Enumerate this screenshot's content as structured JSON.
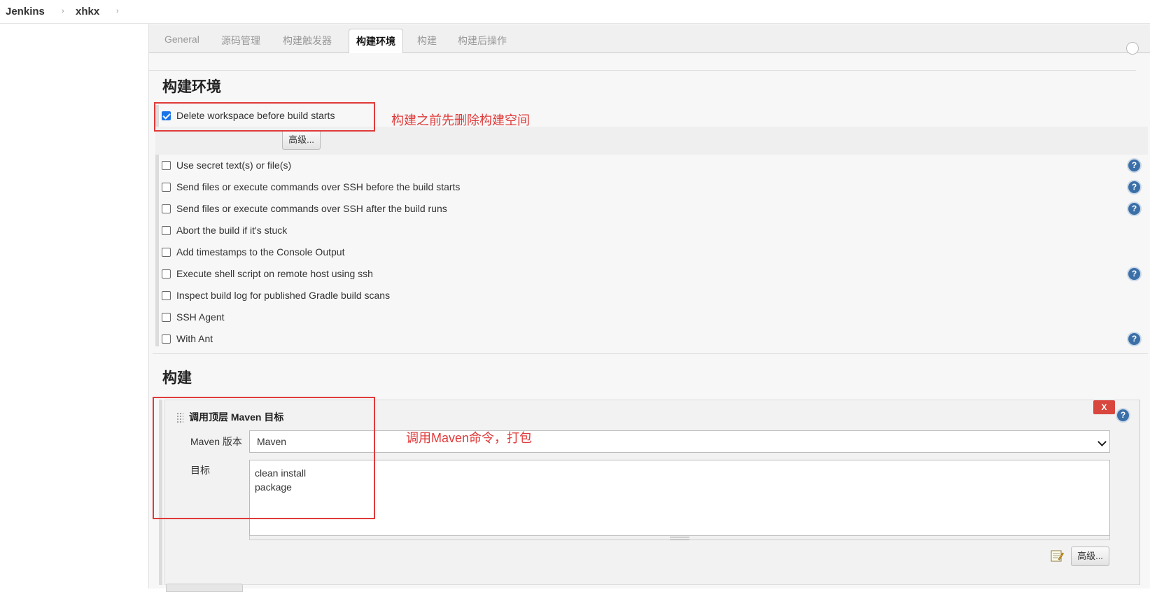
{
  "breadcrumb": {
    "root": "Jenkins",
    "job": "xhkx"
  },
  "tabs": [
    {
      "label": "General"
    },
    {
      "label": "源码管理"
    },
    {
      "label": "构建触发器"
    },
    {
      "label": "构建环境",
      "active": true
    },
    {
      "label": "构建"
    },
    {
      "label": "构建后操作"
    }
  ],
  "build_env": {
    "title": "构建环境",
    "advanced_label": "高级...",
    "options": [
      {
        "label": "Delete workspace before build starts",
        "checked": true
      },
      {
        "label": "Use secret text(s) or file(s)",
        "checked": false,
        "help": true
      },
      {
        "label": "Send files or execute commands over SSH before the build starts",
        "checked": false,
        "help": true
      },
      {
        "label": "Send files or execute commands over SSH after the build runs",
        "checked": false,
        "help": true
      },
      {
        "label": "Abort the build if it's stuck",
        "checked": false,
        "help": false
      },
      {
        "label": "Add timestamps to the Console Output",
        "checked": false,
        "help": false
      },
      {
        "label": "Execute shell script on remote host using ssh",
        "checked": false,
        "help": true
      },
      {
        "label": "Inspect build log for published Gradle build scans",
        "checked": false,
        "help": false
      },
      {
        "label": "SSH Agent",
        "checked": false,
        "help": false
      },
      {
        "label": "With Ant",
        "checked": false,
        "help": true
      }
    ]
  },
  "build": {
    "title": "构建",
    "step_title": "调用顶层 Maven 目标",
    "delete_label": "X",
    "maven_version_label": "Maven 版本",
    "maven_version_value": "Maven",
    "goals_label": "目标",
    "goals_value": "clean install\npackage",
    "advanced_label": "高级..."
  },
  "annotations": {
    "delete_workspace_note": "构建之前先删除构建空间",
    "maven_note": "调用Maven命令，打包"
  },
  "icons": {
    "help": "?",
    "help_icon": "help-icon",
    "notepad_icon": "notepad-icon"
  },
  "colors": {
    "annotation_red": "#e03a3a",
    "help_blue": "#3b6fa8",
    "delete_red": "#d9463d"
  }
}
